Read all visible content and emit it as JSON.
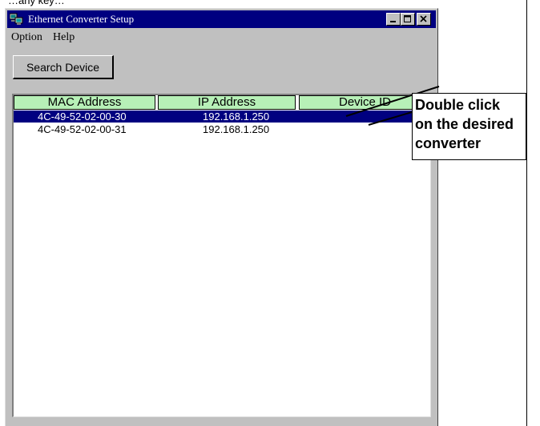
{
  "page": {
    "top_text": "…any key…"
  },
  "window": {
    "title": "Ethernet Converter Setup",
    "controls": {
      "minimize": "minimize",
      "maximize": "maximize",
      "close": "close"
    }
  },
  "menubar": {
    "items": [
      "Option",
      "Help"
    ]
  },
  "toolbar": {
    "search_label": "Search Device"
  },
  "list": {
    "columns": [
      "MAC  Address",
      "IP  Address",
      "Device  ID"
    ],
    "rows": [
      {
        "mac": "4C-49-52-02-00-30",
        "ip": "192.168.1.250",
        "device_id": "",
        "selected": true
      },
      {
        "mac": "4C-49-52-02-00-31",
        "ip": "192.168.1.250",
        "device_id": "",
        "selected": false
      }
    ]
  },
  "callout": {
    "lines": [
      "Double click",
      "on the desired",
      "converter"
    ]
  },
  "colors": {
    "titlebar": "#000080",
    "selection": "#000080",
    "header_bg": "#b7f0b7",
    "window_face": "#c0c0c0"
  }
}
